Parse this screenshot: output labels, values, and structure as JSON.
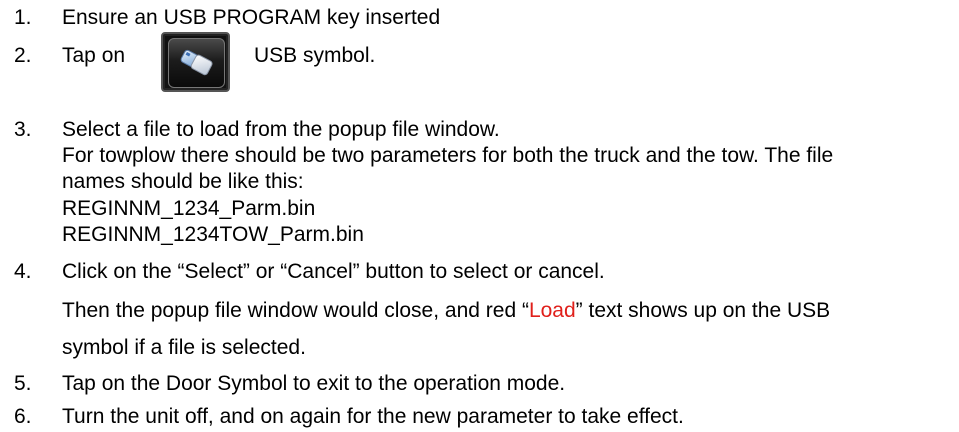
{
  "steps": [
    {
      "num": "1.",
      "text": "Ensure an USB PROGRAM key inserted"
    },
    {
      "num": "2.",
      "before": "Tap on",
      "after": "USB symbol."
    },
    {
      "num": "3.",
      "text": "Select a file to load from the popup file window.",
      "extra": [
        "For towplow there should be two parameters for both the truck and the tow. The file",
        "names should be like this:",
        "REGINNM_1234_Parm.bin",
        "REGINNM_1234TOW_Parm.bin"
      ]
    },
    {
      "num": "4.",
      "text": "Click on the “Select” or “Cancel” button to select or cancel.",
      "extra_prefix": "Then the popup file window would close, and red “",
      "extra_red": "Load",
      "extra_suffix": "” text shows up on the USB",
      "extra2": "symbol if a file is selected."
    },
    {
      "num": "5.",
      "text": "Tap on the Door Symbol to exit to the operation mode."
    },
    {
      "num": "6.",
      "text": "Turn the unit off, and on again for the new parameter to take effect."
    }
  ],
  "icons": {
    "usb": "usb-drive-icon"
  },
  "colors": {
    "highlight": "#e0201b",
    "button_bg": "#111111"
  }
}
